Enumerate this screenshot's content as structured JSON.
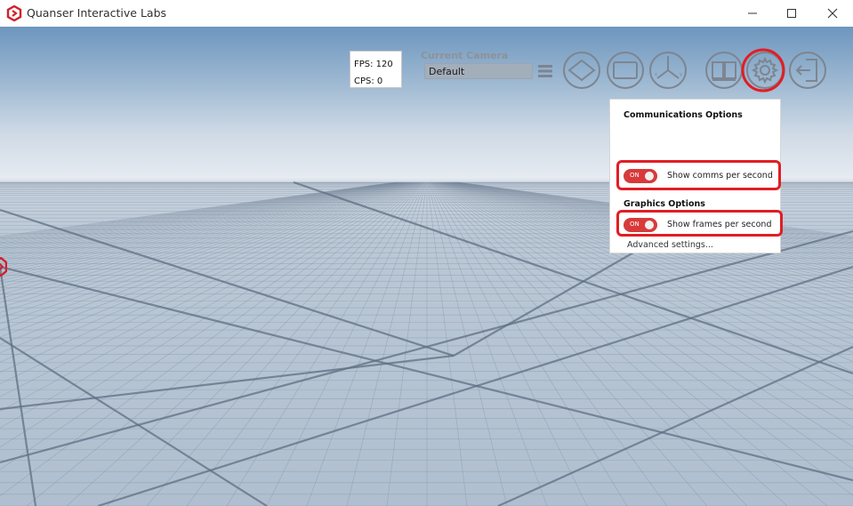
{
  "window": {
    "title": "Quanser Interactive Labs",
    "controls": [
      "minimize-icon",
      "maximize-icon",
      "close-icon"
    ]
  },
  "stats": {
    "fps": "FPS: 120",
    "cps": "CPS: 0"
  },
  "camera": {
    "label": "Current Camera",
    "value": "Default"
  },
  "toolbar": {
    "buttons": [
      "plane-view-icon",
      "screen-view-icon",
      "axes-view-icon",
      "book-icon",
      "gear-icon",
      "exit-icon"
    ],
    "active_button": "gear-icon"
  },
  "settings_panel": {
    "communications_title": "Communications Options",
    "comms_toggle": {
      "state": "ON",
      "label": "Show comms per second"
    },
    "graphics_title": "Graphics Options",
    "fps_toggle": {
      "state": "ON",
      "label": "Show frames per second"
    },
    "advanced_link": "Advanced settings..."
  },
  "colors": {
    "accent": "#d83a3a",
    "annotation": "#e21d24",
    "icon_gray": "#7d8590"
  }
}
